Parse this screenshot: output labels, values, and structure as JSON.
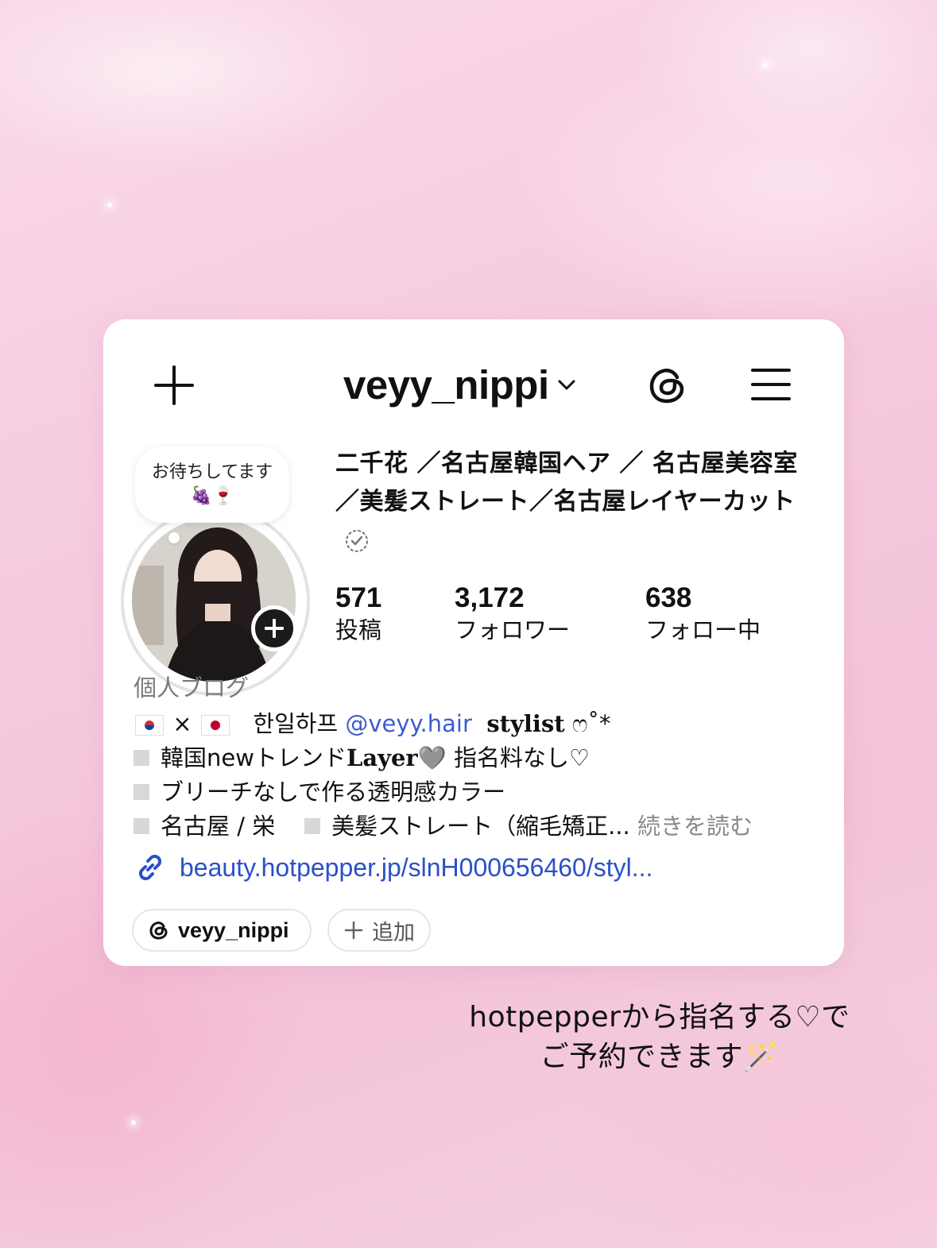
{
  "header": {
    "username": "veyy_nippi"
  },
  "note": {
    "text": "お待ちしてます🍇🍷"
  },
  "profile": {
    "display_name": "二千花 ／名古屋韓国ヘア ／ 名古屋美容室／美髪ストレート／名古屋レイヤーカット",
    "stats": [
      {
        "value": "571",
        "label": "投稿"
      },
      {
        "value": "3,172",
        "label": "フォロワー"
      },
      {
        "value": "638",
        "label": "フォロー中"
      }
    ],
    "category": "個人ブログ",
    "bio": {
      "line1_flags_sep": "×",
      "line1_korean": "한일하프",
      "line1_mention": "@veyy.hair",
      "line1_stylist": "stylist",
      "line1_deco": "ෆ˚*",
      "line2_a": "韓国newトレンド",
      "line2_layer": "Layer",
      "line2_b": "🩶 指名料なし♡",
      "line3": "ブリーチなしで作る透明感カラー",
      "line4_a": "名古屋 / 栄",
      "line4_b": "美髪ストレート（縮毛矯正...",
      "more": "続きを読む"
    },
    "link": "beauty.hotpepper.jp/slnH000656460/styl...",
    "threads_pill": "veyy_nippi",
    "add_pill": "追加"
  },
  "caption": {
    "line1": "hotpepperから指名する♡で",
    "line2": "ご予約できます🪄"
  },
  "colors": {
    "link": "#2b50c8",
    "mention": "#3d5bd1",
    "background": "#f6cade"
  }
}
